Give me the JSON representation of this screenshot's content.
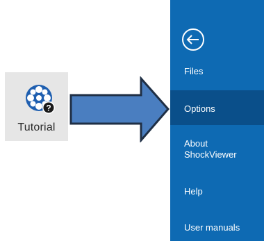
{
  "tutorial": {
    "label": "Tutorial",
    "icon": "film-reel-help-icon"
  },
  "arrow": {
    "icon": "right-arrow-icon",
    "fill": "#4a7ec0",
    "stroke": "#1f2f45"
  },
  "menu": {
    "background": "#0e6ab3",
    "selected_background": "#0a4f8a",
    "back_icon": "back-arrow-circle-icon",
    "items": [
      {
        "label": "Files",
        "selected": false
      },
      {
        "label": "Options",
        "selected": true
      },
      {
        "label_line1": "About",
        "label_line2": "ShockViewer",
        "selected": false
      },
      {
        "label": "Help",
        "selected": false
      },
      {
        "label": "User manuals",
        "selected": false
      }
    ]
  }
}
